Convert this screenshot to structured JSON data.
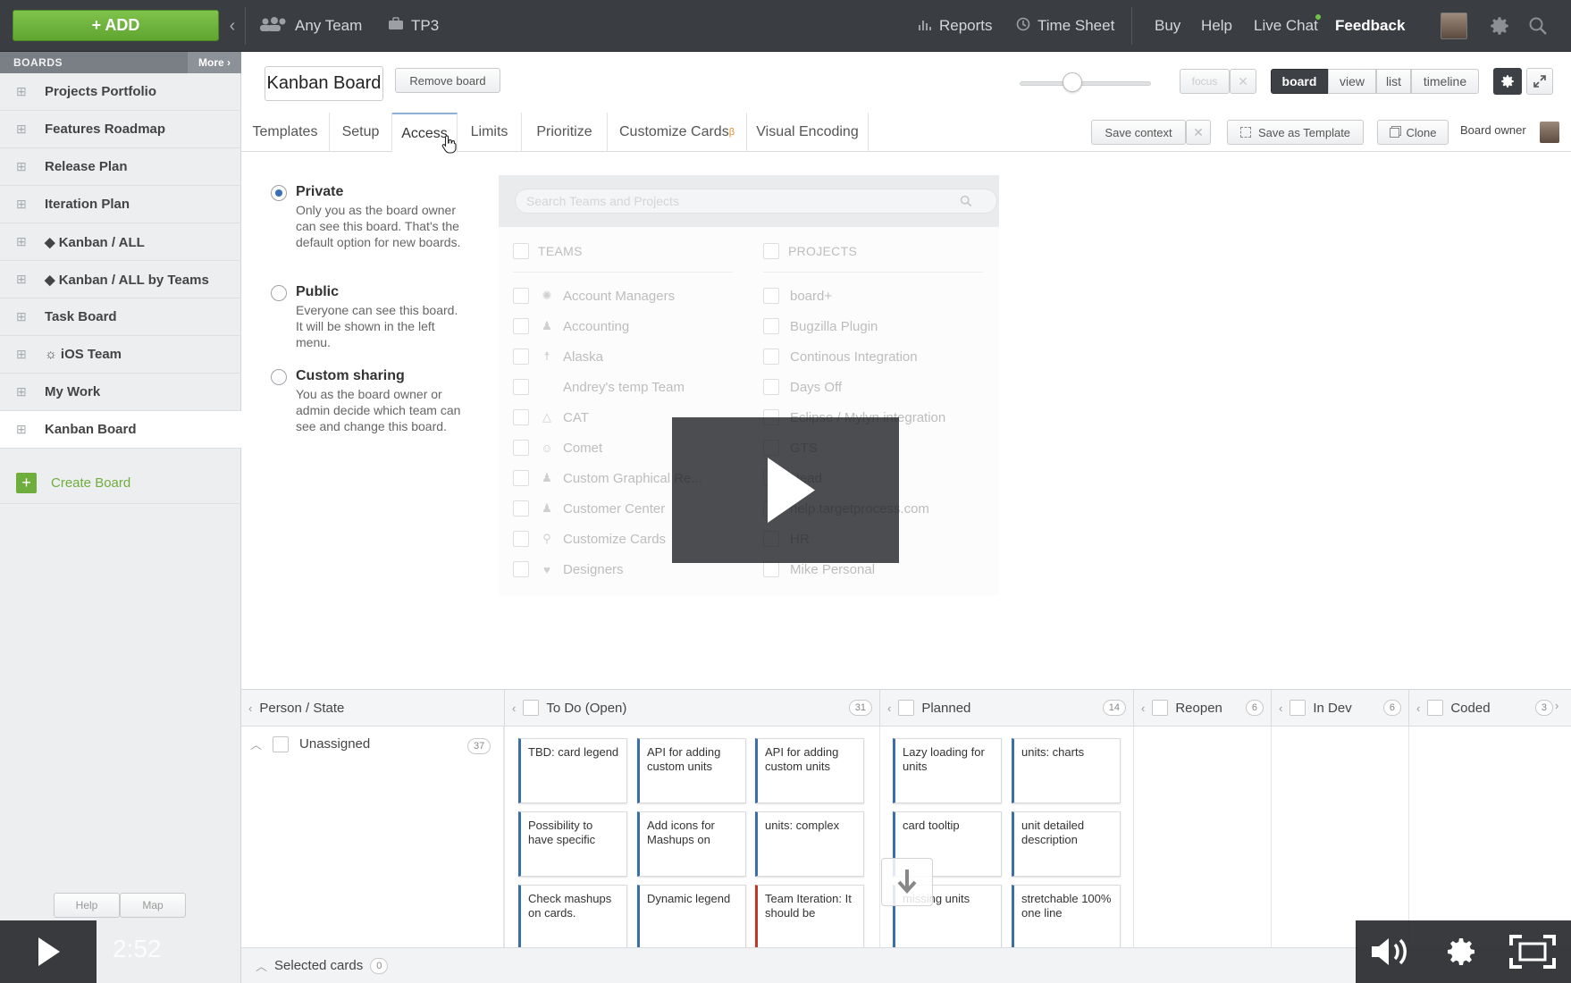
{
  "topbar": {
    "add_label": "+ ADD",
    "team_label": "Any Team",
    "project_label": "TP3",
    "reports": "Reports",
    "timesheet": "Time Sheet",
    "buy": "Buy",
    "help": "Help",
    "livechat": "Live Chat",
    "feedback": "Feedback"
  },
  "sidebar": {
    "header": "BOARDS",
    "more": "More ›",
    "items": [
      {
        "label": "Projects Portfolio"
      },
      {
        "label": "Features Roadmap"
      },
      {
        "label": "Release Plan"
      },
      {
        "label": "Iteration Plan"
      },
      {
        "label": "◆ Kanban / ALL"
      },
      {
        "label": "◆ Kanban / ALL by Teams"
      },
      {
        "label": "Task Board"
      },
      {
        "label": "☼ iOS Team"
      },
      {
        "label": "My Work"
      },
      {
        "label": "Kanban Board"
      }
    ],
    "create": "Create Board"
  },
  "board": {
    "title": "Kanban Board",
    "remove": "Remove board",
    "focus": "focus",
    "views": [
      "board",
      "view",
      "list",
      "timeline"
    ],
    "save_context": "Save context",
    "save_template": "Save as Template",
    "clone": "Clone",
    "owner": "Board owner"
  },
  "tabs": [
    "Templates",
    "Setup",
    "Access",
    "Limits",
    "Prioritize",
    "Customize Cards",
    "Visual Encoding"
  ],
  "tab_beta": "β",
  "access": {
    "options": [
      {
        "title": "Private",
        "desc": "Only you as the board owner can see this board. That's the default option for new boards.",
        "checked": true
      },
      {
        "title": "Public",
        "desc": "Everyone can see this board. It will be shown in the left menu.",
        "checked": false
      },
      {
        "title": "Custom sharing",
        "desc": "You as the board owner or admin decide which team can see and change this board.",
        "checked": false
      }
    ],
    "search_placeholder": "Search Teams and Projects",
    "teams_header": "TEAMS",
    "projects_header": "PROJECTS",
    "teams": [
      "Account Managers",
      "Accounting",
      "Alaska",
      "Andrey's temp Team",
      "CAT",
      "Comet",
      "Custom Graphical Re...",
      "Customer Center",
      "Customize Cards",
      "Designers"
    ],
    "projects": [
      "board+",
      "Bugzilla Plugin",
      "Continous Integration",
      "Days Off",
      "Eclipse / Mylyn integration",
      "GTS",
      "Head",
      "help.targetprocess.com",
      "HR",
      "Mike Personal"
    ]
  },
  "grid": {
    "row_axis": "Person / State",
    "columns": [
      {
        "label": "To Do (Open)",
        "count": "31"
      },
      {
        "label": "Planned",
        "count": "14"
      },
      {
        "label": "Reopen",
        "count": "6"
      },
      {
        "label": "In Dev",
        "count": "6"
      },
      {
        "label": "Coded",
        "count": "3"
      }
    ],
    "lane": {
      "label": "Unassigned",
      "count": "37"
    },
    "todo_cards": [
      "TBD: card legend",
      "API for adding custom units",
      "API for adding custom units",
      "Possibility to have specific",
      "Add icons for Mashups on",
      "units: complex",
      "Check mashups on cards.",
      "Dynamic legend",
      "Team Iteration: It should be"
    ],
    "planned_cards": [
      "Lazy loading for units",
      "units: charts",
      "card tooltip",
      "unit detailed description",
      "missing units",
      "stretchable 100% one line"
    ],
    "selected_label": "Selected cards",
    "selected_count": "0"
  },
  "video": {
    "time": "2:52"
  },
  "footer_tabs": [
    "Help",
    "Map"
  ]
}
